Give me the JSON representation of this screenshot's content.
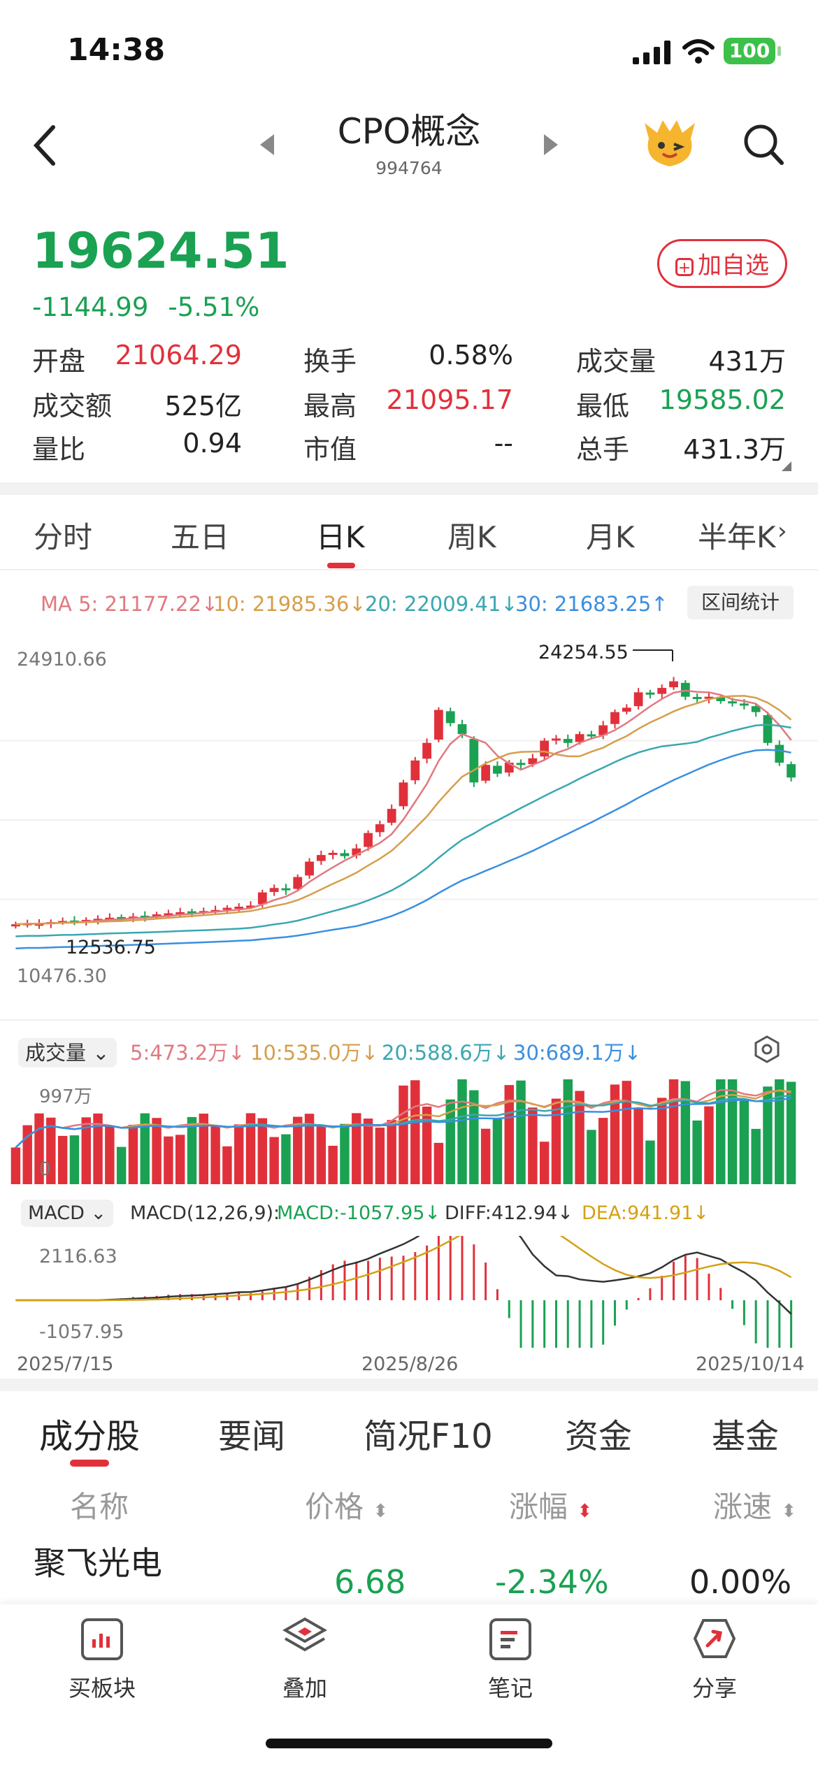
{
  "status": {
    "time": "14:38",
    "battery": "100"
  },
  "header": {
    "title": "CPO概念",
    "code": "994764",
    "add_label": "加自选"
  },
  "quote": {
    "price": "19624.51",
    "change": "-1144.99",
    "change_pct": "-5.51%"
  },
  "stats": [
    [
      {
        "label": "开盘",
        "value": "21064.29",
        "color": "#e0313b"
      },
      {
        "label": "换手",
        "value": "0.58%",
        "color": "#222222"
      },
      {
        "label": "成交量",
        "value": "431万",
        "color": "#222222"
      }
    ],
    [
      {
        "label": "成交额",
        "value": "525亿",
        "color": "#222222"
      },
      {
        "label": "最高",
        "value": "21095.17",
        "color": "#e0313b"
      },
      {
        "label": "最低",
        "value": "19585.02",
        "color": "#1aa152"
      }
    ],
    [
      {
        "label": "量比",
        "value": "0.94",
        "color": "#222222"
      },
      {
        "label": "市值",
        "value": "--",
        "color": "#222222"
      },
      {
        "label": "总手",
        "value": "431.3万",
        "color": "#222222"
      }
    ]
  ],
  "chart_tabs": [
    "分时",
    "五日",
    "日K",
    "周K",
    "月K",
    "半年K"
  ],
  "ma": {
    "ma5": "MA 5: 21177.22↓",
    "ma10": "10: 21985.36↓",
    "ma20": "20: 22009.41↓",
    "ma30": "30: 21683.25↑",
    "range_btn": "区间统计"
  },
  "kline": {
    "max_label": "24910.66",
    "min_label": "10476.30",
    "high_mark": "24254.55",
    "low_mark": "12536.75"
  },
  "volume": {
    "title": "成交量",
    "v5": "5:473.2万↓",
    "v10": "10:535.0万↓",
    "v20": "20:588.6万↓",
    "v30": "30:689.1万↓",
    "max_label": "997万",
    "zero": "0"
  },
  "macd": {
    "title": "MACD",
    "params": "MACD(12,26,9):",
    "macd": "MACD:-1057.95↓",
    "diff": "DIFF:412.94↓",
    "dea": "DEA:941.91↓",
    "top_label": "2116.63",
    "bottom_label": "-1057.95"
  },
  "dates": [
    "2025/7/15",
    "2025/8/26",
    "2025/10/14"
  ],
  "bottom_tabs": [
    "成分股",
    "要闻",
    "简况F10",
    "资金",
    "基金"
  ],
  "table": {
    "headers": [
      "名称",
      "价格",
      "涨幅",
      "涨速"
    ],
    "rows": [
      {
        "name": "聚飞光电",
        "price": "6.68",
        "pct": "-2.34%",
        "speed": "0.00%"
      }
    ]
  },
  "bottom_bar": [
    "买板块",
    "叠加",
    "笔记",
    "分享"
  ],
  "chart_data": {
    "type": "candlestick",
    "x_range": [
      "2025/7/15",
      "2025/10/14"
    ],
    "y_range": [
      10476.3,
      24910.66
    ],
    "series": [
      {
        "name": "MA 5",
        "value": 21177.22
      },
      {
        "name": "10",
        "value": 21985.36
      },
      {
        "name": "20",
        "value": 22009.41
      },
      {
        "name": "30",
        "value": 21683.25
      }
    ],
    "closes": [
      12950,
      13000,
      12980,
      13050,
      13100,
      13060,
      13150,
      13200,
      13250,
      13220,
      13300,
      13280,
      13400,
      13450,
      13500,
      13480,
      13550,
      13600,
      13700,
      13750,
      13800,
      14400,
      14600,
      14500,
      15100,
      15800,
      16100,
      16200,
      16050,
      16400,
      17100,
      17500,
      18200,
      19400,
      20400,
      21200,
      22700,
      22100,
      21600,
      19400,
      20200,
      19800,
      20300,
      20200,
      20500,
      21300,
      21400,
      21200,
      21600,
      21500,
      22000,
      22600,
      22800,
      23500,
      23400,
      23700,
      24000,
      23300,
      23200,
      23300,
      23100,
      23000,
      22900,
      22600,
      21200,
      20300,
      19624.51
    ],
    "volume_max": "997万",
    "macd_range": [
      -1057.95,
      2116.63
    ]
  }
}
